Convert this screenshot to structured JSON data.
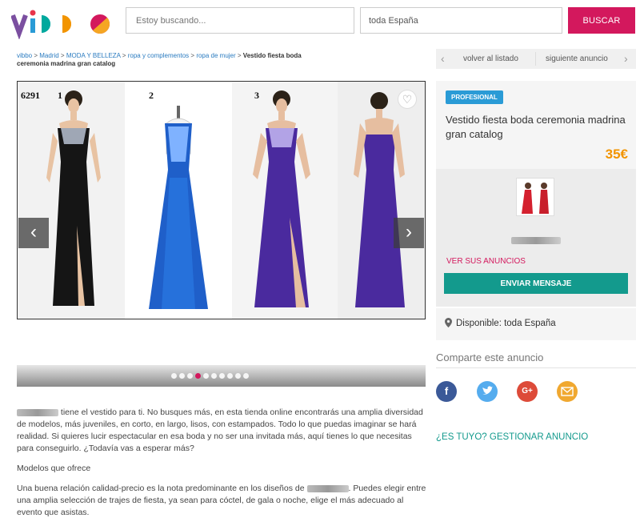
{
  "header": {
    "search_placeholder": "Estoy buscando...",
    "location_value": "toda España",
    "search_button": "BUSCAR",
    "brand_color": "#d3185d"
  },
  "breadcrumb": {
    "items": [
      "vibbo",
      "Madrid",
      "MODA Y BELLEZA",
      "ropa y complementos",
      "ropa de mujer"
    ],
    "current": "Vestido fiesta boda ceremonia madrina gran catalog"
  },
  "nav": {
    "back": "volver al listado",
    "next": "siguiente anuncio"
  },
  "gallery": {
    "panel_labels": [
      "6291",
      "1",
      "2",
      "3"
    ],
    "dot_count": 10,
    "active_dot": 3,
    "prev_icon": "chevron-left-icon",
    "next_icon": "chevron-right-icon",
    "favorite_icon": "heart-icon"
  },
  "listing": {
    "badge": "PROFESIONAL",
    "title": "Vestido fiesta boda ceremonia madrina gran catalog",
    "price": "35€",
    "see_ads": "VER SUS ANUNCIOS",
    "send_message": "ENVIAR MENSAJE",
    "availability": "Disponible: toda España"
  },
  "share": {
    "title": "Comparte este anuncio",
    "icons": [
      "facebook-icon",
      "twitter-icon",
      "google-plus-icon",
      "mail-icon"
    ],
    "google_plus_glyph": "G+"
  },
  "manage": "¿ES TUYO? GESTIONAR ANUNCIO",
  "description": {
    "p1": "tiene el vestido para ti. No busques más, en esta tienda online encontrarás una amplia diversidad de modelos, más juveniles, en corto, en largo, lisos, con estampados. Todo lo que puedas imaginar se hará realidad. Si quieres lucir espectacular en esa boda y no ser una invitada más, aquí tienes lo que necesitas para conseguirlo. ¿Todavía vas a esperar más?",
    "p2": "Modelos que ofrece",
    "p3a": "Una buena relación calidad-precio es la nota predominante en los diseños de",
    "p3b": ". Puedes elegir entre una amplia selección de trajes de fiesta, ya sean para cóctel, de gala o noche, elige el más adecuado al evento que asistas."
  }
}
